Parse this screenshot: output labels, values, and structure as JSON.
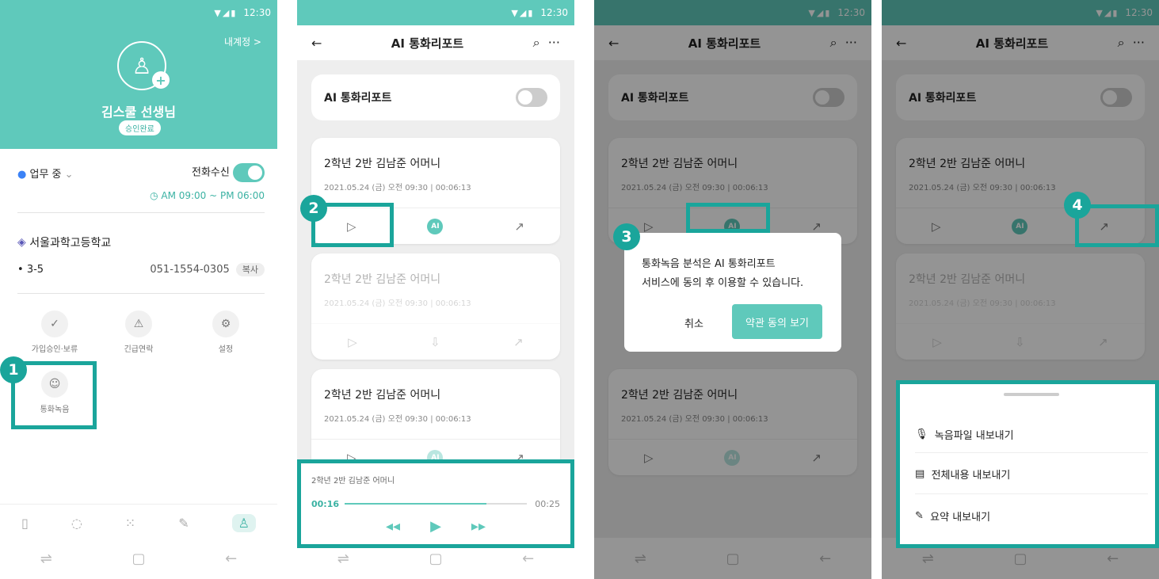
{
  "status": {
    "time": "12:30",
    "icons": "▼◢▮"
  },
  "screen1": {
    "my_account": "내계정 >",
    "teacher_name": "김스쿨 선생님",
    "approval_badge": "승인완료",
    "work_status": "업무 중",
    "call_receive_label": "전화수신",
    "call_hours": "AM 09:00 ~ PM 06:00",
    "school_name": "서울과학고등학교",
    "class_label": "3-5",
    "phone": "051-1554-0305",
    "copy_label": "복사",
    "menu": {
      "approve": "가입승인·보류",
      "emergency": "긴급연락",
      "settings": "설정",
      "recording": "통화녹음"
    }
  },
  "app": {
    "title": "AI 통화리포트",
    "toggle_label": "AI 통화리포트"
  },
  "cards": [
    {
      "name": "2학년 2반 김남준 어머니",
      "date": "2021.05.24 (금) 오전 09:30  |  00:06:13"
    }
  ],
  "player": {
    "title": "2학년 2반 김남준 어머니",
    "current": "00:16",
    "total": "00:25",
    "progress": 0.78
  },
  "dialog": {
    "line1": "통화녹음 분석은 AI 통화리포트",
    "line2": "서비스에 동의 후 이용할 수 있습니다.",
    "cancel": "취소",
    "confirm": "약관 동의 보기"
  },
  "sheet": {
    "export_audio": "녹음파일 내보내기",
    "export_full": "전체내용 내보내기",
    "export_summary": "요약 내보내기"
  },
  "steps": [
    "1",
    "2",
    "3",
    "4"
  ],
  "colors": {
    "accent": "#5fc9bb",
    "highlight": "#1aa59b"
  }
}
